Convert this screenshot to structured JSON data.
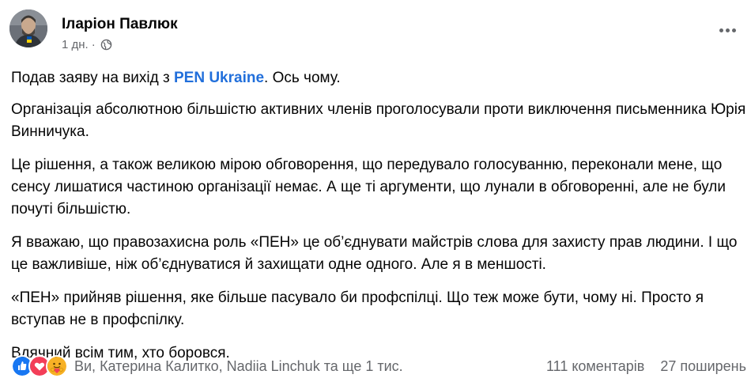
{
  "post": {
    "author": "Іларіон Павлюк",
    "time": "1 дн.",
    "separator": "·",
    "link_text": "PEN Ukraine",
    "para1_before": "Подав заяву на вихід з ",
    "para1_after": ". Ось чому.",
    "para2": "Організація абсолютною більшістю активних членів проголосували проти виключення письменника Юрія Винничука.",
    "para3": "Це рішення, а також великою мірою обговорення, що передувало голосуванню, переконали мене, що сенсу лишатися частиною організації немає. А ще ті аргументи, що лунали в обговоренні, але не були почуті більшістю.",
    "para4": "Я вважаю, що правозахисна роль «ПЕН» це об’єднувати майстрів слова для захисту прав людини. І що це  важливіше, ніж об’єднуватися й захищати одне одного.  Але я в меншості.",
    "para5": "«ПЕН» прийняв рішення, яке більше пасувало би профспілці. Що теж може бути, чому ні. Просто я вступав не в профспілку.",
    "para6": "Вдячний всім тим, хто боровся."
  },
  "footer": {
    "reactions_text": "Ви, Катерина Калитко, Nadiia Linchuk та ще 1 тис.",
    "comments": "111 коментарів",
    "shares": "27 поширень"
  },
  "icons": {
    "like": "like-icon",
    "love": "love-icon",
    "care": "care-icon",
    "globe": "globe-icon",
    "more": "more-options-icon"
  },
  "colors": {
    "link": "#216fdb",
    "secondary_text": "#65676b",
    "like": "#1877f2",
    "love": "#f33e58",
    "care": "#f7b125"
  }
}
